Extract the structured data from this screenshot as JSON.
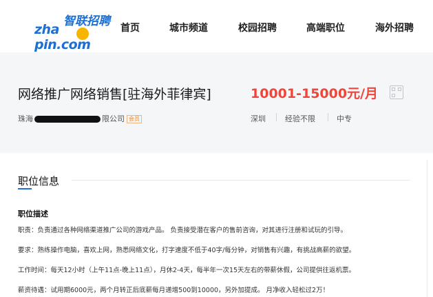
{
  "header": {
    "logo": {
      "text_en_left": "zha",
      "text_en_right": "pin.com",
      "text_cn": "智联招聘"
    },
    "nav": [
      "首页",
      "城市频道",
      "校园招聘",
      "高端职位",
      "海外招聘"
    ]
  },
  "job": {
    "title": "网络推广网络销售[驻海外菲律宾]",
    "salary": "10001-15000元/月",
    "company_prefix": "珠海",
    "company_suffix": "限公司",
    "member_badge": "会员",
    "location": "深圳",
    "experience": "经验不限",
    "education": "中专"
  },
  "section": {
    "title": "职位信息",
    "desc_title": "职位描述",
    "lines": [
      "职责：负责通过各种网络渠道推广公司的游戏产品。 负责接受潜在客户的售前咨询，对其进行注册和试玩的引导。",
      "要求：熟练操作电脑，喜欢上网，熟悉网络文化，打字速度不低于40字/每分钟，对销售有兴趣，有挑战高薪的欲望。",
      "工作时间：每天12小时（上午11点-晚上11点），月休2-4天，每半年一次15天左右的带薪休假，公司提供往返机票。",
      "薪资待遇：试用期6000元，两个月转正后底薪每月递增500到10000，另外加提成。 月净收入轻松过2万！"
    ]
  },
  "colors": {
    "brand_blue": "#1d6fd4",
    "salary_red": "#f0453b",
    "logo_yellow": "#f7b500"
  }
}
